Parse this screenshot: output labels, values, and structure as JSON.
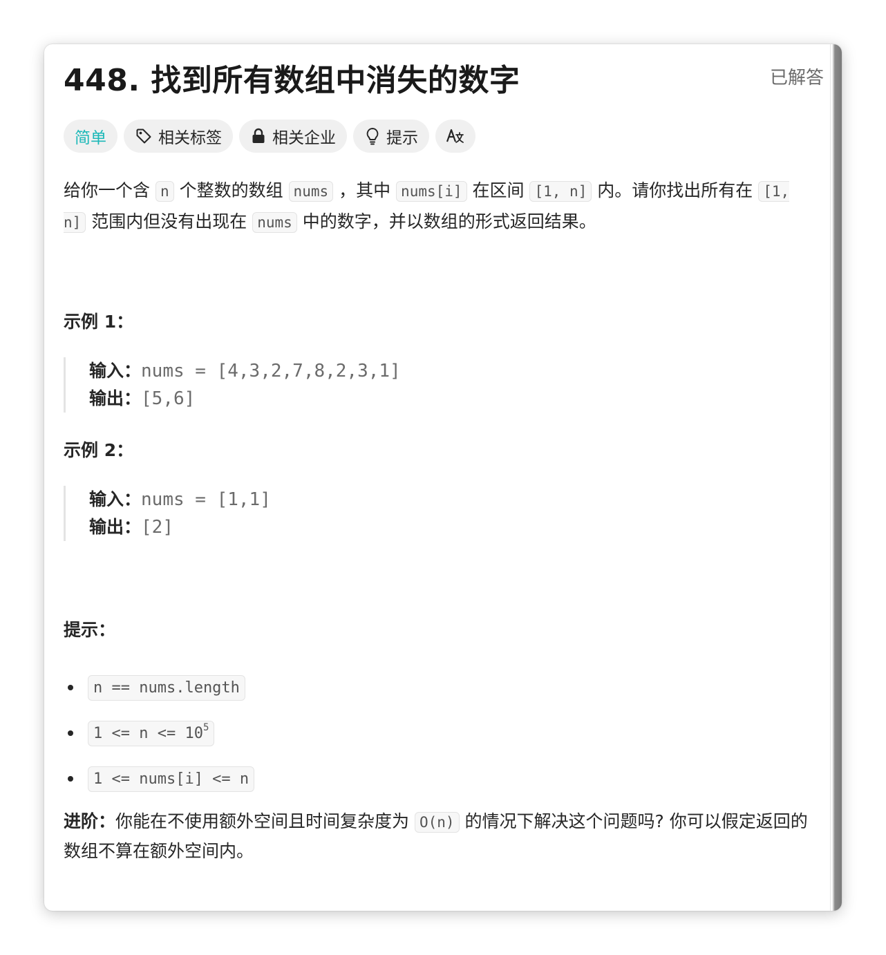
{
  "problem": {
    "title": "448. 找到所有数组中消失的数字",
    "status": "已解答",
    "colors": {
      "easy": "#1cb8b8",
      "solved": "#2db55d"
    }
  },
  "tags": [
    {
      "label": "简单",
      "icon": ""
    },
    {
      "label": "相关标签",
      "icon": "tag-icon"
    },
    {
      "label": "相关企业",
      "icon": "lock-icon"
    },
    {
      "label": "提示",
      "icon": "lightbulb-icon"
    },
    {
      "label": "",
      "icon": "translate-icon"
    }
  ],
  "description": {
    "p1": "给你一个含",
    "c1": "n",
    "p2": "个整数的数组",
    "c2": "nums",
    "p3": "，其中",
    "c3": "nums[i]",
    "p4": "在区间",
    "c4": "[1, n]",
    "p5": "内。请你找出所有在",
    "c5": "[1, n]",
    "p6": "范围内但没有出现在",
    "c6": "nums",
    "p7": "中的数字，并以数组的形式返回结果。"
  },
  "examples": [
    {
      "heading": "示例 1：",
      "input_label": "输入：",
      "input": "nums = [4,3,2,7,8,2,3,1]",
      "output_label": "输出：",
      "output": "[5,6]"
    },
    {
      "heading": "示例 2：",
      "input_label": "输入：",
      "input": "nums = [1,1]",
      "output_label": "输出：",
      "output": "[2]"
    }
  ],
  "constraints": {
    "heading": "提示：",
    "items": [
      {
        "text": "n == nums.length",
        "sup": ""
      },
      {
        "text": "1 <= n <= 10",
        "sup": "5"
      },
      {
        "text": "1 <= nums[i] <= n",
        "sup": ""
      }
    ]
  },
  "advanced": {
    "label": "进阶：",
    "t1": "你能在不使用额外空间且时间复杂度为",
    "code": "O(n)",
    "t2": "的情况下解决这个问题吗? 你可以假定返回的数组不算在额外空间内。"
  }
}
